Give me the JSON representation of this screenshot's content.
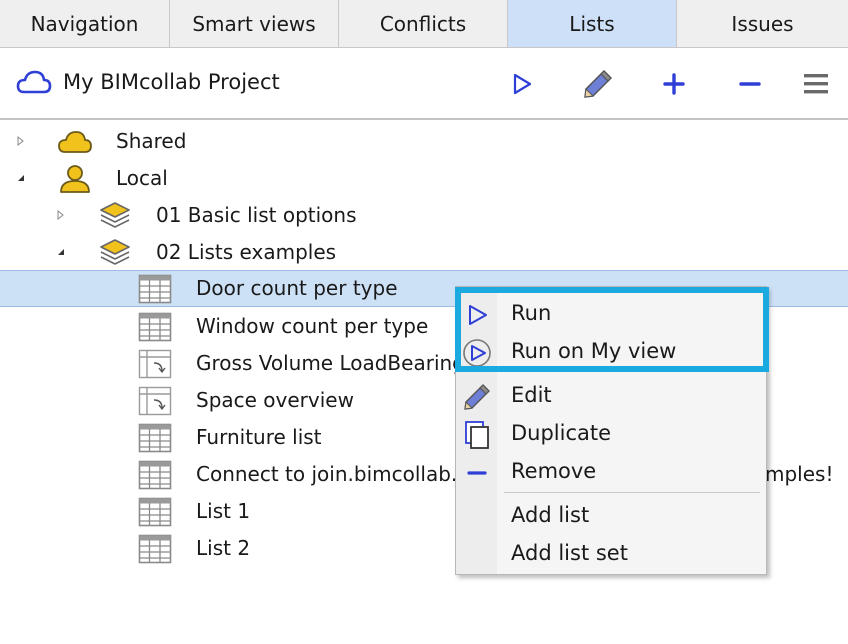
{
  "tabs": [
    {
      "label": "Navigation",
      "active": false
    },
    {
      "label": "Smart views",
      "active": false
    },
    {
      "label": "Conflicts",
      "active": false
    },
    {
      "label": "Lists",
      "active": true
    },
    {
      "label": "Issues",
      "active": false
    }
  ],
  "toolbar": {
    "project_title": "My BIMcollab Project",
    "buttons": [
      "run-icon",
      "edit-icon",
      "add-icon",
      "remove-icon",
      "menu-icon"
    ]
  },
  "tree": {
    "shared": "Shared",
    "local": "Local",
    "set1": "01 Basic list options",
    "set2": "02 Lists examples",
    "items": [
      "Door count per type",
      "Window count per type",
      "Gross Volume LoadBearing",
      "Space overview",
      "Furniture list",
      "Connect to join.bimcollab.com",
      "mples!",
      "List 1",
      "List 2"
    ]
  },
  "context_menu": {
    "run": "Run",
    "run_on_view": "Run on My view",
    "edit": "Edit",
    "duplicate": "Duplicate",
    "remove": "Remove",
    "add_list": "Add list",
    "add_list_set": "Add list set"
  },
  "colors": {
    "accent_blue": "#2f3fd6",
    "tab_active": "#cde0f7",
    "selection": "#cce0f6",
    "highlight": "#1aaae0",
    "folder_yellow": "#f1c21b"
  }
}
